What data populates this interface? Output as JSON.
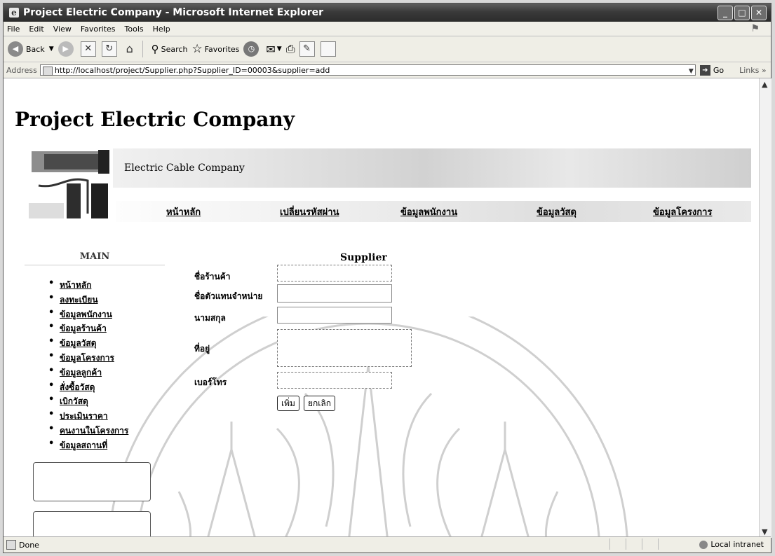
{
  "window": {
    "title": "Project Electric Company - Microsoft Internet Explorer"
  },
  "menu": {
    "items": [
      "File",
      "Edit",
      "View",
      "Favorites",
      "Tools",
      "Help"
    ]
  },
  "toolbar": {
    "back_label": "Back",
    "search_label": "Search",
    "favorites_label": "Favorites"
  },
  "address": {
    "label": "Address",
    "url": "http://localhost/project/Supplier.php?Supplier_ID=00003&supplier=add",
    "go_label": "Go",
    "links_label": "Links"
  },
  "status": {
    "text": "Done",
    "zone": "Local intranet"
  },
  "page": {
    "title": "Project Electric Company",
    "tagline": "Electric Cable Company",
    "topnav": [
      "หน้าหลัก",
      "เปลี่ยนรหัสผ่าน",
      "ข้อมูลพนักงาน",
      "ข้อมูลวัสดุ",
      "ข้อมูลโครงการ"
    ],
    "sidebar": {
      "title": "MAIN",
      "items": [
        "หน้าหลัก",
        "ลงทะเบียน",
        "ข้อมูลพนักงาน",
        "ข้อมูลร้านค้า",
        "ข้อมูลวัสดุ",
        "ข้อมูลโครงการ",
        "ข้อมูลลูกค้า",
        "สั่งซื้อวัสดุ",
        "เบิกวัสดุ",
        "ประเมินราคา",
        "คนงานในโครงการ",
        "ข้อมูลสถานที่"
      ]
    },
    "form": {
      "title": "Supplier",
      "labels": {
        "shop_name": "ชื่อร้านค้า",
        "rep_name": "ชื่อตัวแทนจำหน่าย",
        "surname": "นามสกุล",
        "address": "ที่อยู่",
        "phone": "เบอร์โทร"
      },
      "values": {
        "shop_name": "",
        "rep_name": "",
        "surname": "",
        "address": "",
        "phone": ""
      },
      "add_button": "เพิ่ม",
      "cancel_button": "ยกเลิก"
    }
  }
}
